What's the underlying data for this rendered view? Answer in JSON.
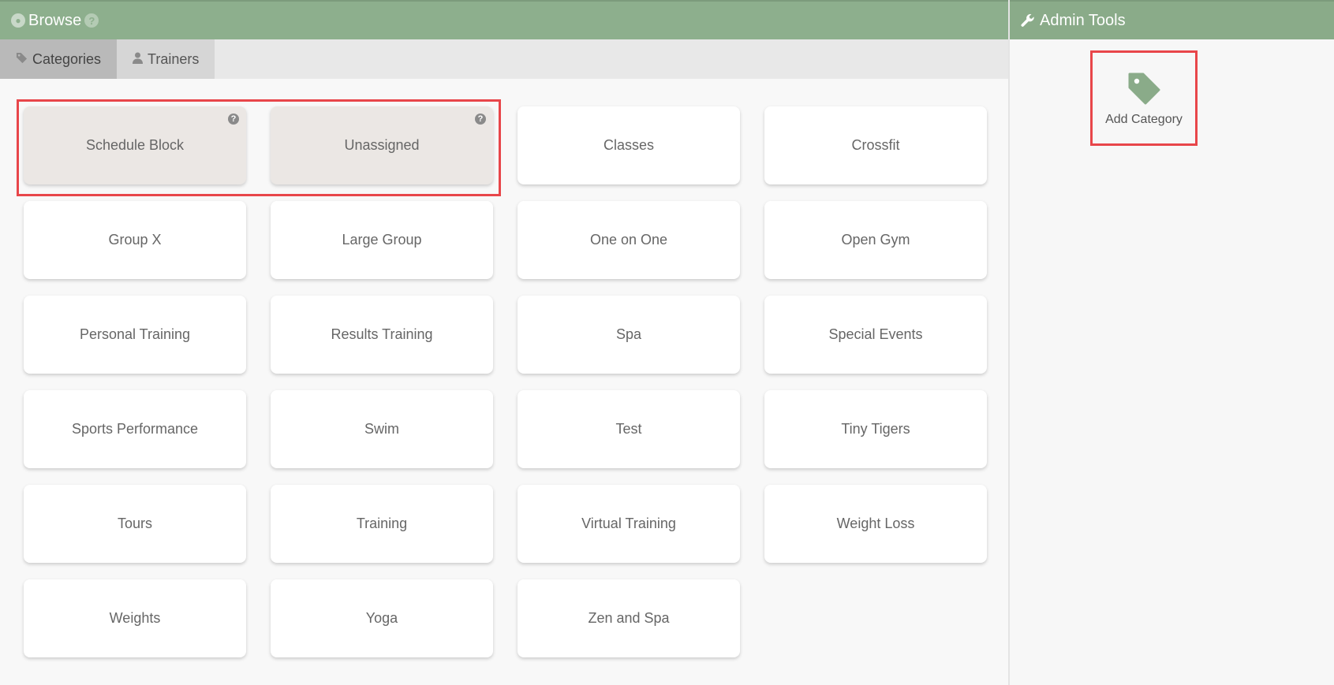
{
  "browse": {
    "title": "Browse",
    "help_glyph": "?",
    "globe_glyph": "◉"
  },
  "tabs": [
    {
      "label": "Categories",
      "icon": "tag-icon"
    },
    {
      "label": "Trainers",
      "icon": "user-icon"
    }
  ],
  "categories": [
    {
      "label": "Schedule Block",
      "special": true
    },
    {
      "label": "Unassigned",
      "special": true
    },
    {
      "label": "Classes"
    },
    {
      "label": "Crossfit"
    },
    {
      "label": "Group X"
    },
    {
      "label": "Large Group"
    },
    {
      "label": "One on One"
    },
    {
      "label": "Open Gym"
    },
    {
      "label": "Personal Training"
    },
    {
      "label": "Results Training"
    },
    {
      "label": "Spa"
    },
    {
      "label": "Special Events"
    },
    {
      "label": "Sports Performance"
    },
    {
      "label": "Swim"
    },
    {
      "label": "Test"
    },
    {
      "label": "Tiny Tigers"
    },
    {
      "label": "Tours"
    },
    {
      "label": "Training"
    },
    {
      "label": "Virtual Training"
    },
    {
      "label": "Weight Loss"
    },
    {
      "label": "Weights"
    },
    {
      "label": "Yoga"
    },
    {
      "label": "Zen and Spa"
    }
  ],
  "admin": {
    "title": "Admin Tools",
    "add_category_label": "Add Category"
  },
  "colors": {
    "header_green": "#8daf8d",
    "highlight_red": "#e8464a",
    "tag_green": "#8aab89"
  }
}
